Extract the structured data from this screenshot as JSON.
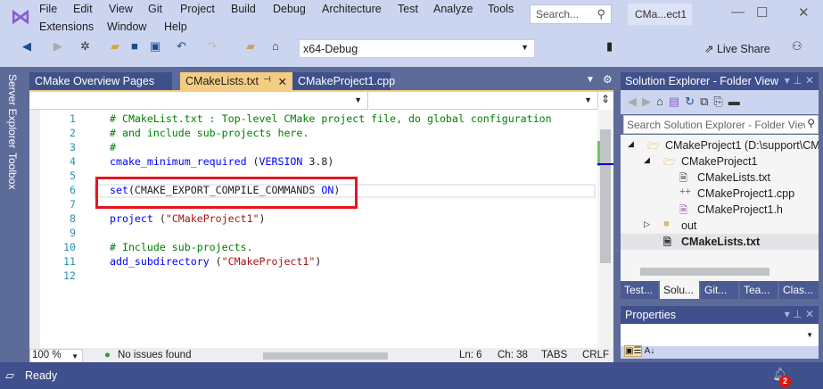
{
  "menu": [
    "File",
    "Edit",
    "View",
    "Git",
    "Project",
    "Build",
    "Debug",
    "Architecture",
    "Test",
    "Analyze",
    "Tools",
    "Extensions",
    "Window",
    "Help"
  ],
  "search_placeholder": "Search...",
  "project_title": "CMa...ect1",
  "toolbar": {
    "config": "x64-Debug",
    "live_share": "Live Share"
  },
  "side_tabs": [
    "Server Explorer",
    "Toolbox"
  ],
  "doc_tabs": [
    {
      "label": "CMake Overview Pages",
      "active": false
    },
    {
      "label": "CMakeLists.txt",
      "active": true
    },
    {
      "label": "CMakeProject1.cpp",
      "active": false
    }
  ],
  "code_lines": [
    [
      {
        "t": "# CMakeList.txt : Top-level CMake project file, do global configuration",
        "c": "cm"
      }
    ],
    [
      {
        "t": "# and include sub-projects here.",
        "c": "cm"
      }
    ],
    [
      {
        "t": "#",
        "c": "cm"
      }
    ],
    [
      {
        "t": "cmake_minimum_required",
        "c": "kw"
      },
      {
        "t": " (",
        "c": ""
      },
      {
        "t": "VERSION",
        "c": "kw"
      },
      {
        "t": " 3.8)",
        "c": ""
      }
    ],
    [],
    [
      {
        "t": "set",
        "c": "kw"
      },
      {
        "t": "(CMAKE_EXPORT_COMPILE_COMMANDS ",
        "c": ""
      },
      {
        "t": "ON",
        "c": "kw"
      },
      {
        "t": ")",
        "c": ""
      }
    ],
    [],
    [
      {
        "t": "project",
        "c": "kw"
      },
      {
        "t": " (",
        "c": ""
      },
      {
        "t": "\"CMakeProject1\"",
        "c": "st"
      },
      {
        "t": ")",
        "c": ""
      }
    ],
    [],
    [
      {
        "t": "# Include sub-projects.",
        "c": "cm"
      }
    ],
    [
      {
        "t": "add_subdirectory",
        "c": "kw"
      },
      {
        "t": " (",
        "c": ""
      },
      {
        "t": "\"CMakeProject1\"",
        "c": "st"
      },
      {
        "t": ")",
        "c": ""
      }
    ],
    []
  ],
  "editor_status": {
    "zoom": "100 %",
    "issues": "No issues found",
    "ln": "Ln: 6",
    "ch": "Ch: 38",
    "tabs": "TABS",
    "eol": "CRLF"
  },
  "status": "Ready",
  "notifications": "2",
  "solution_explorer": {
    "title": "Solution Explorer - Folder View",
    "search_placeholder": "Search Solution Explorer - Folder View",
    "tree": [
      {
        "label": "CMakeProject1 (D:\\support\\CMakeProject1)",
        "icon": "folder-open-icon",
        "depth": 0,
        "expander": "◢"
      },
      {
        "label": "CMakeProject1",
        "icon": "folder-open-icon",
        "depth": 1,
        "expander": "◢"
      },
      {
        "label": "CMakeLists.txt",
        "icon": "file-icon",
        "depth": 2,
        "expander": ""
      },
      {
        "label": "CMakeProject1.cpp",
        "icon": "cpp-icon",
        "depth": 2,
        "expander": ""
      },
      {
        "label": "CMakeProject1.h",
        "icon": "header-icon",
        "depth": 2,
        "expander": ""
      },
      {
        "label": "out",
        "icon": "folder-icon",
        "depth": 1,
        "expander": "▷"
      },
      {
        "label": "CMakeLists.txt",
        "icon": "file-icon",
        "depth": 1,
        "expander": "",
        "selected": true
      }
    ],
    "bottom_tabs": [
      {
        "label": "Test...",
        "active": false
      },
      {
        "label": "Solu...",
        "active": true
      },
      {
        "label": "Git...",
        "active": false
      },
      {
        "label": "Tea...",
        "active": false
      },
      {
        "label": "Clas...",
        "active": false
      }
    ]
  },
  "properties": {
    "title": "Properties"
  }
}
